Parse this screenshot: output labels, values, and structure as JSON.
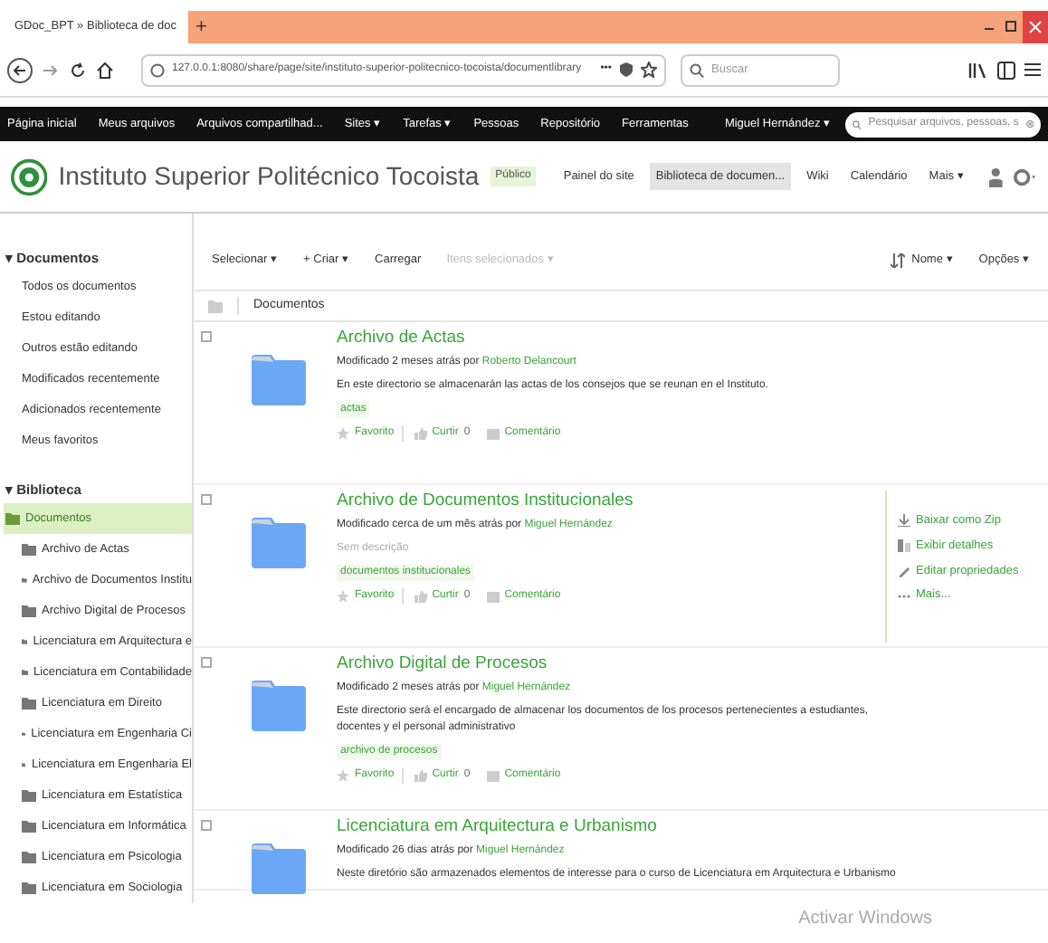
{
  "browser": {
    "tab_title": "GDoc_BPT » Biblioteca de doc",
    "new_tab": "+",
    "url": "127.0.0.1:8080/share/page/site/instituto-superior-politecnico-tocoista/documentlibrary",
    "more": "•••",
    "search_placeholder": "Buscar"
  },
  "app_nav": {
    "items": [
      "Página inicial",
      "Meus arquivos",
      "Arquivos compartilhad...",
      "Sites ▾",
      "Tarefas ▾",
      "Pessoas",
      "Repositório",
      "Ferramentas"
    ],
    "user": "Miguel Hernández ▾",
    "search_placeholder": "Pesquisar arquivos, pessoas, s"
  },
  "site": {
    "title": "Instituto Superior Politécnico Tocoista",
    "badge": "Público",
    "links": [
      {
        "label": "Painel do site",
        "selected": false
      },
      {
        "label": "Biblioteca de documen...",
        "selected": true
      },
      {
        "label": "Wiki",
        "selected": false
      },
      {
        "label": "Calendário",
        "selected": false
      },
      {
        "label": "Mais ▾",
        "selected": false
      }
    ]
  },
  "sidebar": {
    "documents_header": "▾ Documentos",
    "filters": [
      "Todos os documentos",
      "Estou editando",
      "Outros estão editando",
      "Modificados recentemente",
      "Adicionados recentemente",
      "Meus favoritos"
    ],
    "library_header": "▾ Biblioteca",
    "tree": [
      {
        "label": "Documentos",
        "selected": true,
        "children": [
          {
            "label": "Archivo de Actas",
            "selected": false
          },
          {
            "label": "Archivo de Documentos Institu",
            "selected": false
          },
          {
            "label": "Archivo Digital de Procesos",
            "selected": false
          },
          {
            "label": "Licenciatura em Arquitectura e",
            "selected": false
          },
          {
            "label": "Licenciatura em Contabilidade",
            "selected": false
          },
          {
            "label": "Licenciatura em Direito",
            "selected": false
          },
          {
            "label": "Licenciatura em Engenharia Ci",
            "selected": false
          },
          {
            "label": "Licenciatura em Engenharia El",
            "selected": false
          },
          {
            "label": "Licenciatura em Estatística",
            "selected": false
          },
          {
            "label": "Licenciatura em Informática",
            "selected": false
          },
          {
            "label": "Licenciatura em Psicologia",
            "selected": false
          },
          {
            "label": "Licenciatura em Sociologia",
            "selected": false
          }
        ]
      }
    ]
  },
  "toolbar": {
    "buttons": [
      {
        "label": "Selecionar ▾",
        "disabled": false
      },
      {
        "label": "+ Criar ▾",
        "disabled": false
      },
      {
        "label": "Carregar",
        "disabled": false
      },
      {
        "label": "Itens selecionados ▾",
        "disabled": true
      }
    ],
    "sort": "Nome ▾",
    "options": "Opções ▾"
  },
  "breadcrumb": "Documentos",
  "items": [
    {
      "title": "Archivo de Actas",
      "modified": "Modificado 2 meses atrás por",
      "author": "Roberto Delancourt",
      "description": "En este directorio se almacenarán las actas de los consejos que se reunan en el Instituto.",
      "description_muted": false,
      "tag": "actas",
      "favorite": "Favorito",
      "like": "Curtir",
      "likes": "0",
      "comment": "Comentário",
      "hovered": false,
      "checked": false
    },
    {
      "title": "Archivo de Documentos Institucionales",
      "modified": "Modificado cerca de um mês atrás por",
      "author": "Miguel Hernández",
      "description": "Sem descrição",
      "description_muted": true,
      "tag": "documentos institucionales",
      "favorite": "Favorito",
      "like": "Curtir",
      "likes": "0",
      "comment": "Comentário",
      "hovered": true,
      "checked": false
    },
    {
      "title": "Archivo Digital de Procesos",
      "modified": "Modificado 2 meses atrás por",
      "author": "Miguel Hernández",
      "description": "Este directorio será el encargado de almacenar los documentos de los procesos pertenecientes a estudiantes, docentes y el personal administrativo",
      "description_muted": false,
      "tag": "archivo de procesos",
      "favorite": "Favorito",
      "like": "Curtir",
      "likes": "0",
      "comment": "Comentário",
      "hovered": false,
      "checked": false
    },
    {
      "title": "Licenciatura em Arquitectura e Urbanismo",
      "modified": "Modificado 26 dias atrás por",
      "author": "Miguel Hernández",
      "description": "Neste diretório são armazenados elementos de interesse para o curso de Licenciatura em Arquitectura e Urbanismo",
      "description_muted": false,
      "hovered": false,
      "checked": false
    }
  ],
  "item_actions": [
    "Baixar como Zip",
    "Exibir detalhes",
    "Editar propriedades",
    "Mais..."
  ],
  "os_notice": "Activar Windows"
}
